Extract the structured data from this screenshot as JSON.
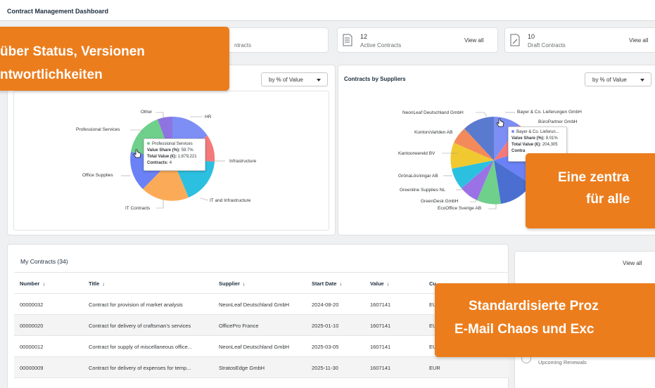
{
  "app": {
    "title": "Contract Management Dashboard"
  },
  "tiles": [
    {
      "count": "",
      "label": "ntracts",
      "icon": "document-icon"
    },
    {
      "count": "12",
      "label": "Active Contracts",
      "icon": "document-list-icon",
      "view_all": "View all"
    },
    {
      "count": "10",
      "label": "Draft Contracts",
      "icon": "document-edit-icon",
      "view_all": "View all"
    }
  ],
  "panel_left": {
    "dropdown": "by % of Value",
    "labels": [
      "Other",
      "HR",
      "Professional Services",
      "Infrastructure",
      "Office Supplies",
      "IT and Infrastructure",
      "IT Contracts"
    ],
    "tooltip": {
      "name": "Professional Services",
      "share_label": "Value Share (%):",
      "share_value": "59.7%",
      "total_label": "Total Value (€):",
      "total_value": "1,679,221",
      "contracts_label": "Contracts:",
      "contracts_value": "4"
    }
  },
  "panel_right": {
    "title": "Contracts by Suppliers",
    "dropdown": "by % of Value",
    "labels": [
      "NeonLeaf Deutschland GmbH",
      "Bayer & Co. Lieferungen GmbH",
      "BüroPartner GmbH",
      "KontorsVarlden AB",
      "Kantoorwereld BV",
      "GrönaLösningar AB",
      "Greenline Supplies NL",
      "GreenDesk GmbH",
      "EcoOffice Sverige AB"
    ],
    "tooltip": {
      "name": "Bayer & Co. Lieferun...",
      "share_label": "Value Share (%):",
      "share_value": "8.01%",
      "total_label": "Total Value (€):",
      "total_value": "204,305",
      "contracts_label": "Contra"
    }
  },
  "table": {
    "title": "My Contracts (34)",
    "columns": [
      "Number",
      "Title",
      "Supplier",
      "Start Date",
      "Value",
      "Cu"
    ],
    "rows": [
      {
        "number": "00000032",
        "title": "Contract for provision of market analysis",
        "supplier": "NeonLeaf Deutschland GmbH",
        "start": "2024-08-20",
        "value": "1607141",
        "cur": "EU"
      },
      {
        "number": "00000020",
        "title": "Contract for delivery of craftsman's services",
        "supplier": "OfficePro France",
        "start": "2025-01-10",
        "value": "1607141",
        "cur": "EU"
      },
      {
        "number": "00000012",
        "title": "Contract for supply of miscellaneous office...",
        "supplier": "NeonLeaf Deutschland GmbH",
        "start": "2025-03-05",
        "value": "1607141",
        "cur": "EU"
      },
      {
        "number": "00000009",
        "title": "Contract for delivery of expenses for temp...",
        "supplier": "StratosEdge GmbH",
        "start": "2025-11-30",
        "value": "1607141",
        "cur": "EUR"
      }
    ]
  },
  "side_panel": {
    "view_all": "View all",
    "item": "Upcoming Renewals"
  },
  "banners": {
    "top_left": [
      "über Status, Versionen",
      "ntwortlichkeiten"
    ],
    "right": [
      "Eine zentra",
      "für alle"
    ],
    "bottom": [
      "Standardisierte Proz",
      "E-Mail Chaos und Exc"
    ]
  },
  "colors": {
    "accent": "#ec7d1d"
  }
}
